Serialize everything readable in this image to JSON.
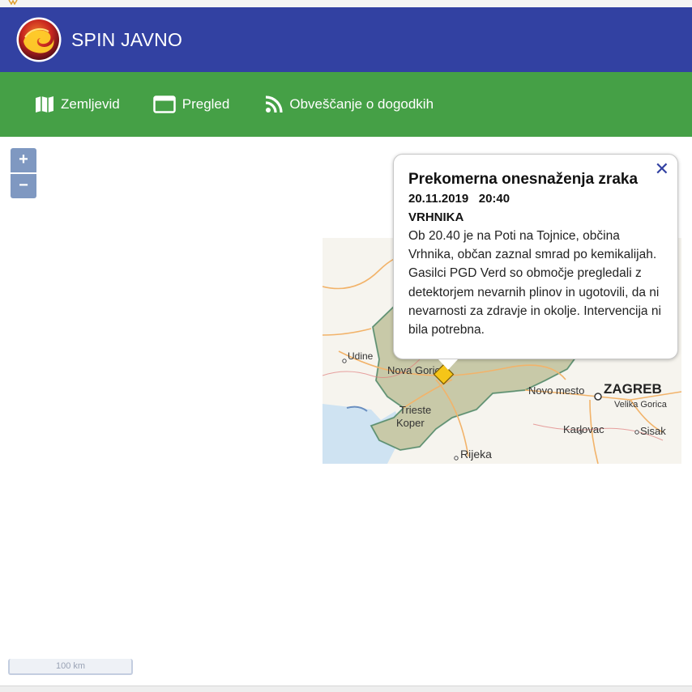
{
  "header": {
    "title": "SPIN JAVNO",
    "bg_color": "#3241a2"
  },
  "nav": {
    "bg_color": "#45a046",
    "items": [
      {
        "label": "Zemljevid",
        "icon": "map-icon"
      },
      {
        "label": "Pregled",
        "icon": "window-icon"
      },
      {
        "label": "Obveščanje o dogodkih",
        "icon": "rss-icon"
      }
    ]
  },
  "map": {
    "zoom_in": "+",
    "zoom_out": "−",
    "scale_label": "100 km",
    "places": [
      "Udine",
      "Nova Gorica",
      "Trieste",
      "Koper",
      "Rijeka",
      "Novo mesto",
      "ZAGREB",
      "Velika Gorica",
      "Karlovac",
      "Sisak"
    ],
    "marker_color": "#f5c518"
  },
  "popup": {
    "close": "✕",
    "title": "Prekomerna onesnaženja zraka",
    "date": "20.11.2019   20:40",
    "place": "VRHNIKA",
    "text": "Ob 20.40 je na Poti na Tojnice, občina Vrhnika, občan zaznal smrad po kemikalijah. Gasilci PGD Verd so območje pregledali z detektorjem nevarnih plinov in ugotovili, da ni nevarnosti za zdravje in okolje. Intervencija ni bila potrebna."
  }
}
